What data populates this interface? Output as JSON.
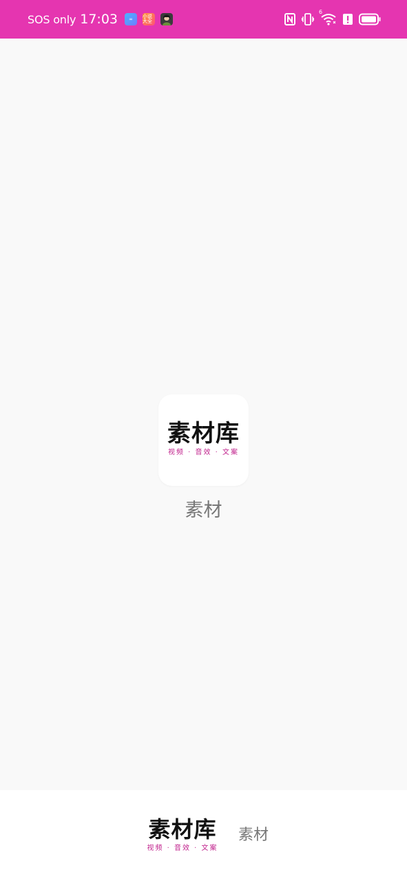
{
  "status_bar": {
    "carrier": "SOS only",
    "time": "17:03",
    "notification_icons": [
      {
        "name": "chat-app-icon",
        "text": "∞"
      },
      {
        "name": "novel-app-icon",
        "text": "小说大全"
      },
      {
        "name": "avatar-app-icon",
        "text": ""
      }
    ],
    "system_icons": [
      "nfc-icon",
      "vibrate-icon",
      "wifi-6-icon",
      "alert-icon",
      "battery-icon"
    ],
    "wifi_generation": "6",
    "background_color": "#e535b0"
  },
  "splash": {
    "icon_logo_text": "素材库",
    "icon_logo_subtitle": "视频 · 音效 · 文案",
    "app_name": "素材"
  },
  "footer": {
    "logo_text": "素材库",
    "logo_subtitle": "视频 · 音效 · 文案",
    "app_name": "素材"
  },
  "colors": {
    "accent": "#c1238d",
    "status_bar": "#e535b0",
    "background": "#f9f9f9"
  }
}
